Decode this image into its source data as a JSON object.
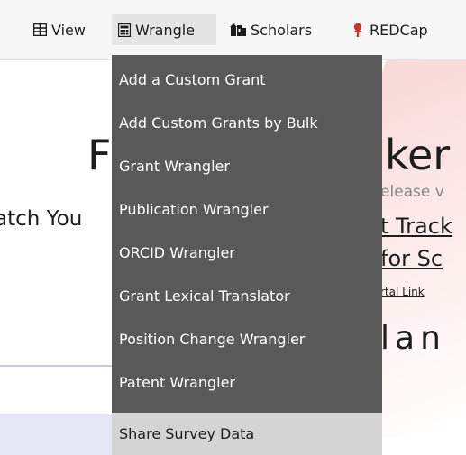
{
  "nav": {
    "items": [
      {
        "label": "View",
        "icon": "table-icon"
      },
      {
        "label": "Wrangle",
        "icon": "calculator-icon"
      },
      {
        "label": "Scholars",
        "icon": "scholars-icon"
      },
      {
        "label": "REDCap",
        "icon": "redcap-icon"
      }
    ],
    "active": "Wrangle"
  },
  "dropdown": {
    "items": [
      "Add a Custom Grant",
      "Add Custom Grants by Bulk",
      "Grant Wrangler",
      "Publication Wrangler",
      "ORCID Wrangler",
      "Grant Lexical Translator",
      "Position Change Wrangler",
      "Patent Wrangler",
      "Share Survey Data"
    ],
    "highlighted": "Share Survey Data"
  },
  "background": {
    "title_left": "F",
    "title_right": "ker",
    "subtitle_left": "atch You",
    "please_text": "elease v",
    "link_1": "t Track",
    "link_2": "for Sc",
    "link_3": "rtal Link",
    "plan_text": "lan"
  },
  "colors": {
    "menu_bg": "#595959",
    "menu_highlight": "#d4d4d4",
    "navbar_bg": "#f7f7f7",
    "accent_pink": "#f8d7d5",
    "accent_lavender": "#e7e6f7",
    "redcap_red": "#c0392b"
  }
}
